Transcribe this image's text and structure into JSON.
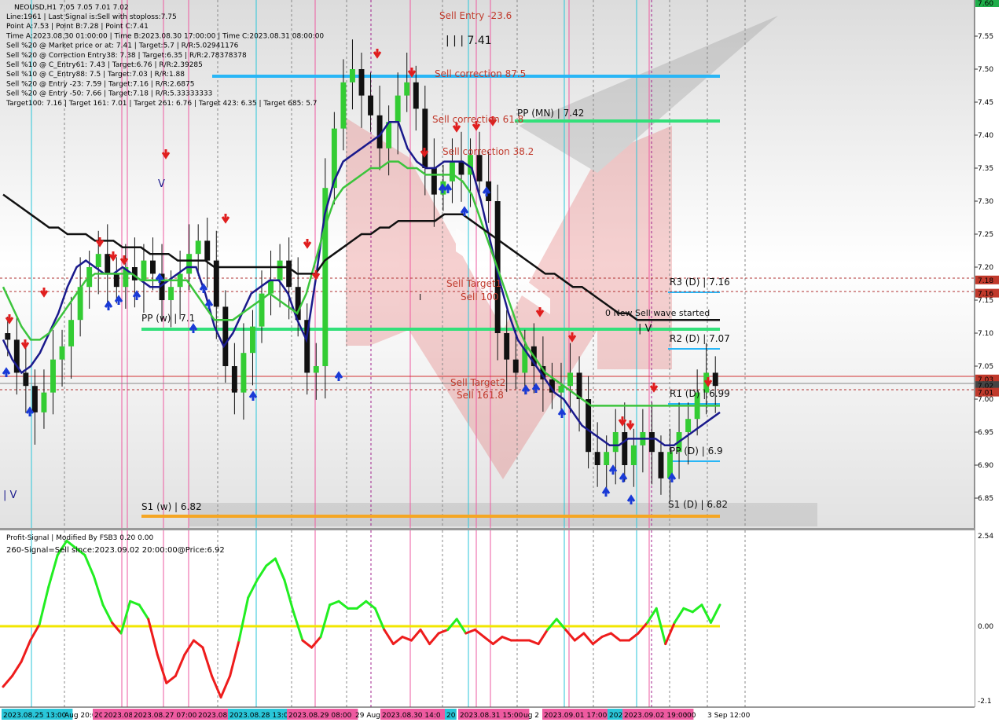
{
  "header": {
    "symbol_line": "NEOUSD,H1  7.05 7.05 7.01 7.02",
    "info_lines": [
      "Line:1961 | Last Signal is:Sell with stoploss:7.75",
      "Point A:7.53 | Point B:7.28 | Point C:7.41",
      "Time A:2023.08.30 01:00:00 | Time B:2023.08.30 17:00:00 | Time C:2023.08.31 08:00:00",
      "Sell %20 @ Market price or at: 7.41 | Target:5.7 | R/R:5.02941176",
      "Sell %20 @ Correction Entry38: 7.38 | Target:6.35 | R/R:2.78378378",
      "Sell %10 @ C_Entry61: 7.43 | Target:6.76 | R/R:2.39285",
      "Sell %10 @ C_Entry88: 7.5 | Target:7.03 | R/R:1.88",
      "Sell %20 @ Entry -23: 7.59 | Target:7.16 | R/R:2.6875",
      "Sell %20 @ Entry -50: 7.66 | Target:7.18 | R/R:5.33333333",
      "Target100: 7.16 | Target 161: 7.01 | Target 261: 6.76 | Target 423: 6.35 | Target 685: 5.7"
    ]
  },
  "annotations": {
    "sell_entry": "Sell Entry -23.6",
    "entry_price": "| | | 7.41",
    "sell_correction_875": "Sell correction 87.5",
    "sell_correction_618": "Sell correction 61.8",
    "sell_correction_382": "Sell correction 38.2",
    "pp_mn": "PP (MN) | 7.42",
    "sell_target1": "Sell Target1",
    "sell_100": "Sell 100",
    "sell_target2": "Sell Target2",
    "sell_1618": "Sell 161.8",
    "pp_w": "PP (w) | 7.1",
    "s1_w": "S1 (w) | 6.82",
    "r3_d": "R3 (D) | 7.16",
    "r2_d": "R2 (D) | 7.07",
    "r1_d": "R1 (D) | 6.99",
    "pp_d": "PP (D) | 6.9",
    "s1_d": "S1 (D) | 6.82",
    "new_wave": "0 New Sell wave started",
    "wave_mark": "| V",
    "v_left": "| V",
    "v_top": "V",
    "i_mark": "I"
  },
  "price_tags": [
    {
      "value": 7.18,
      "label": "7.18",
      "color": "#c0392b"
    },
    {
      "value": 7.16,
      "label": "7.16",
      "color": "#c0392b"
    },
    {
      "value": 7.03,
      "label": "7.03",
      "color": "#c0392b"
    },
    {
      "value": 7.02,
      "label": "7.02",
      "color": "#444444"
    },
    {
      "value": 7.01,
      "label": "7.01",
      "color": "#c0392b"
    },
    {
      "value": 7.6,
      "label": "7.60",
      "color": "#1fae4a"
    }
  ],
  "indicator": {
    "title": "Profit-Signal | Modified By FSB3 0.20 0.00",
    "signal": "260-Signal=Sell since:2023.09.02 20:00:00@Price:6.92",
    "ticks": [
      "2.54",
      "0.00",
      "-2.1"
    ]
  },
  "time_labels": [
    {
      "text": "2023.08.25 13:00",
      "bg": "#29c6d9"
    },
    {
      "text": "Aug 20:00",
      "bg": ""
    },
    {
      "text": "20",
      "bg": "#ee5aa0"
    },
    {
      "text": "2023.08.",
      "bg": "#ee5aa0"
    },
    {
      "text": "2023.08.27 07:00",
      "bg": "#ee5aa0"
    },
    {
      "text": "2023.08.",
      "bg": "#ee5aa0"
    },
    {
      "text": "2023.08.28 13:00",
      "bg": "#29c6d9"
    },
    {
      "text": "2023.08.29 08:00",
      "bg": "#ee5aa0"
    },
    {
      "text": "29 Aug",
      "bg": ""
    },
    {
      "text": "2023.08.30 14:0",
      "bg": "#ee5aa0"
    },
    {
      "text": "20",
      "bg": "#29c6d9"
    },
    {
      "text": "2023.08.31 15:00",
      "bg": "#ee5aa0"
    },
    {
      "text": "ug 2",
      "bg": ""
    },
    {
      "text": "2023.09.01 17:00",
      "bg": "#ee5aa0"
    },
    {
      "text": "2023",
      "bg": "#29c6d9"
    },
    {
      "text": "2023.09.02 19:00",
      "bg": "#ee5aa0"
    },
    {
      "text": ":00",
      "bg": ""
    },
    {
      "text": "3 Sep 12:00",
      "bg": ""
    }
  ],
  "chart_data": [
    {
      "type": "line",
      "title": "NEOUSD,H1",
      "ylim": [
        6.8,
        7.6
      ],
      "y_ticks": [
        6.85,
        6.9,
        6.95,
        7.0,
        7.05,
        7.1,
        7.15,
        7.2,
        7.25,
        7.3,
        7.35,
        7.4,
        7.45,
        7.5,
        7.55
      ],
      "grid": false,
      "close": [
        7.09,
        7.04,
        7.02,
        6.98,
        7.01,
        7.06,
        7.08,
        7.12,
        7.17,
        7.2,
        7.22,
        7.19,
        7.17,
        7.2,
        7.18,
        7.21,
        7.19,
        7.15,
        7.17,
        7.19,
        7.22,
        7.24,
        7.21,
        7.14,
        7.05,
        7.01,
        7.07,
        7.11,
        7.16,
        7.18,
        7.21,
        7.17,
        7.12,
        7.04,
        7.05,
        7.32,
        7.41,
        7.48,
        7.5,
        7.46,
        7.43,
        7.38,
        7.42,
        7.46,
        7.48,
        7.44,
        7.35,
        7.31,
        7.33,
        7.36,
        7.34,
        7.37,
        7.33,
        7.3,
        7.1,
        7.06,
        7.04,
        7.08,
        7.05,
        7.03,
        7.01,
        7.02,
        7.04,
        7.0,
        6.92,
        6.9,
        6.92,
        6.95,
        6.9,
        6.93,
        6.95,
        6.92,
        6.88,
        6.92,
        6.95,
        6.97,
        7.01,
        7.04,
        7.02
      ],
      "series": [
        {
          "name": "",
          "color": "#1a1a8c",
          "values": [
            7.09,
            7.06,
            7.04,
            7.05,
            7.07,
            7.1,
            7.13,
            7.17,
            7.2,
            7.21,
            7.2,
            7.19,
            7.19,
            7.2,
            7.19,
            7.18,
            7.17,
            7.17,
            7.18,
            7.19,
            7.2,
            7.2,
            7.16,
            7.11,
            7.08,
            7.1,
            7.13,
            7.16,
            7.17,
            7.18,
            7.18,
            7.16,
            7.12,
            7.09,
            7.18,
            7.28,
            7.33,
            7.36,
            7.37,
            7.38,
            7.39,
            7.4,
            7.42,
            7.42,
            7.38,
            7.36,
            7.35,
            7.35,
            7.36,
            7.36,
            7.36,
            7.35,
            7.3,
            7.24,
            7.18,
            7.13,
            7.09,
            7.07,
            7.05,
            7.03,
            7.01,
            7.0,
            6.98,
            6.96,
            6.95,
            6.94,
            6.93,
            6.93,
            6.94,
            6.94,
            6.94,
            6.94,
            6.93,
            6.93,
            6.94,
            6.95,
            6.96,
            6.97,
            6.98
          ]
        },
        {
          "name": "",
          "color": "#3cc43c",
          "values": [
            7.17,
            7.14,
            7.11,
            7.09,
            7.09,
            7.1,
            7.12,
            7.14,
            7.16,
            7.18,
            7.19,
            7.19,
            7.19,
            7.19,
            7.19,
            7.18,
            7.18,
            7.18,
            7.18,
            7.18,
            7.18,
            7.16,
            7.14,
            7.12,
            7.12,
            7.12,
            7.13,
            7.14,
            7.15,
            7.16,
            7.15,
            7.14,
            7.13,
            7.16,
            7.21,
            7.26,
            7.3,
            7.32,
            7.33,
            7.34,
            7.35,
            7.35,
            7.36,
            7.36,
            7.35,
            7.35,
            7.34,
            7.34,
            7.34,
            7.34,
            7.33,
            7.31,
            7.27,
            7.23,
            7.19,
            7.15,
            7.11,
            7.08,
            7.06,
            7.04,
            7.03,
            7.02,
            7.01,
            7.0,
            6.99,
            6.99,
            6.99,
            6.99,
            6.99,
            6.99,
            6.99,
            6.99,
            6.99,
            6.99,
            6.99,
            6.99,
            6.99,
            6.99,
            6.99
          ]
        },
        {
          "name": "",
          "color": "#111111",
          "values": [
            7.31,
            7.3,
            7.29,
            7.28,
            7.27,
            7.26,
            7.26,
            7.25,
            7.25,
            7.25,
            7.24,
            7.24,
            7.24,
            7.23,
            7.23,
            7.23,
            7.22,
            7.22,
            7.22,
            7.21,
            7.21,
            7.21,
            7.21,
            7.2,
            7.2,
            7.2,
            7.2,
            7.2,
            7.2,
            7.2,
            7.2,
            7.2,
            7.19,
            7.19,
            7.19,
            7.21,
            7.22,
            7.23,
            7.24,
            7.25,
            7.25,
            7.26,
            7.26,
            7.27,
            7.27,
            7.27,
            7.27,
            7.27,
            7.28,
            7.28,
            7.28,
            7.27,
            7.26,
            7.25,
            7.24,
            7.23,
            7.22,
            7.21,
            7.2,
            7.19,
            7.19,
            7.18,
            7.17,
            7.17,
            7.16,
            7.15,
            7.14,
            7.13,
            7.13,
            7.12,
            7.12,
            7.12,
            7.12,
            7.12,
            7.12,
            7.12,
            7.12,
            7.12,
            7.12
          ]
        }
      ]
    },
    {
      "type": "line",
      "title": "Profit-Signal | Modified By FSB3 0.20 0.00",
      "ylim": [
        -2.1,
        2.54
      ],
      "y_ticks": [
        2.54,
        0.0,
        -2.1
      ],
      "series": [
        {
          "name": "",
          "color": "#22ee22",
          "values": [
            -1.7,
            -1.4,
            -1.0,
            -0.4,
            0.05,
            1.1,
            2.0,
            2.4,
            2.2,
            2.0,
            1.4,
            0.6,
            0.1,
            -0.2,
            0.7,
            0.6,
            0.2,
            -0.8,
            -1.6,
            -1.4,
            -0.8,
            -0.4,
            -0.6,
            -1.4,
            -2.0,
            -1.4,
            -0.4,
            0.8,
            1.3,
            1.7,
            1.9,
            1.3,
            0.4,
            -0.4,
            -0.6,
            -0.3,
            0.6,
            0.7,
            0.5,
            0.5,
            0.7,
            0.5,
            -0.1,
            -0.5,
            -0.3,
            -0.4,
            -0.1,
            -0.5,
            -0.2,
            -0.1,
            0.2,
            -0.2,
            -0.1,
            -0.3,
            -0.5,
            -0.3,
            -0.4,
            -0.4,
            -0.4,
            -0.5,
            -0.1,
            0.2,
            -0.1,
            -0.4,
            -0.2,
            -0.5,
            -0.3,
            -0.2,
            -0.4,
            -0.4,
            -0.2,
            0.1,
            0.5,
            -0.5,
            0.1,
            0.5,
            0.4,
            0.6,
            0.1,
            0.6
          ]
        }
      ]
    }
  ]
}
